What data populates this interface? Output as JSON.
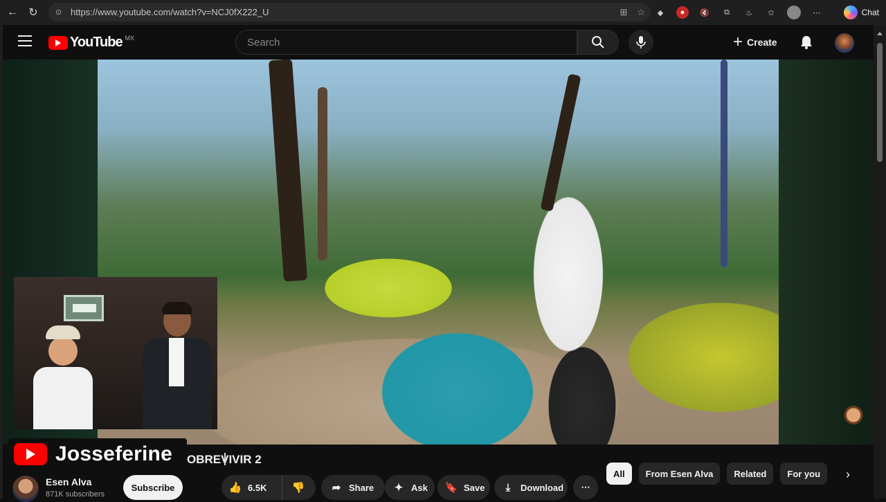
{
  "browser": {
    "url": "https://www.youtube.com/watch?v=NCJ0fX222_U",
    "chat_label": "Chat"
  },
  "header": {
    "logo_text": "YouTube",
    "country_code": "MX",
    "search_placeholder": "Search",
    "create_label": "Create"
  },
  "video": {
    "watermark_channel": "Josseferine",
    "title_fragment": "OBREVIVIR 2"
  },
  "channel": {
    "name": "Esen Alva",
    "subscribers": "871K subscribers",
    "subscribe_label": "Subscribe"
  },
  "actions": {
    "like_count": "6.5K",
    "share_label": "Share",
    "ask_label": "Ask",
    "save_label": "Save",
    "download_label": "Download",
    "more_label": "⋯"
  },
  "chips": [
    {
      "label": "All",
      "active": true
    },
    {
      "label": "From Esen Alva",
      "active": false
    },
    {
      "label": "Related",
      "active": false
    },
    {
      "label": "For you",
      "active": false
    }
  ],
  "colors": {
    "brand_red": "#ff0000",
    "background": "#0f0f0f",
    "pill": "#272727"
  }
}
